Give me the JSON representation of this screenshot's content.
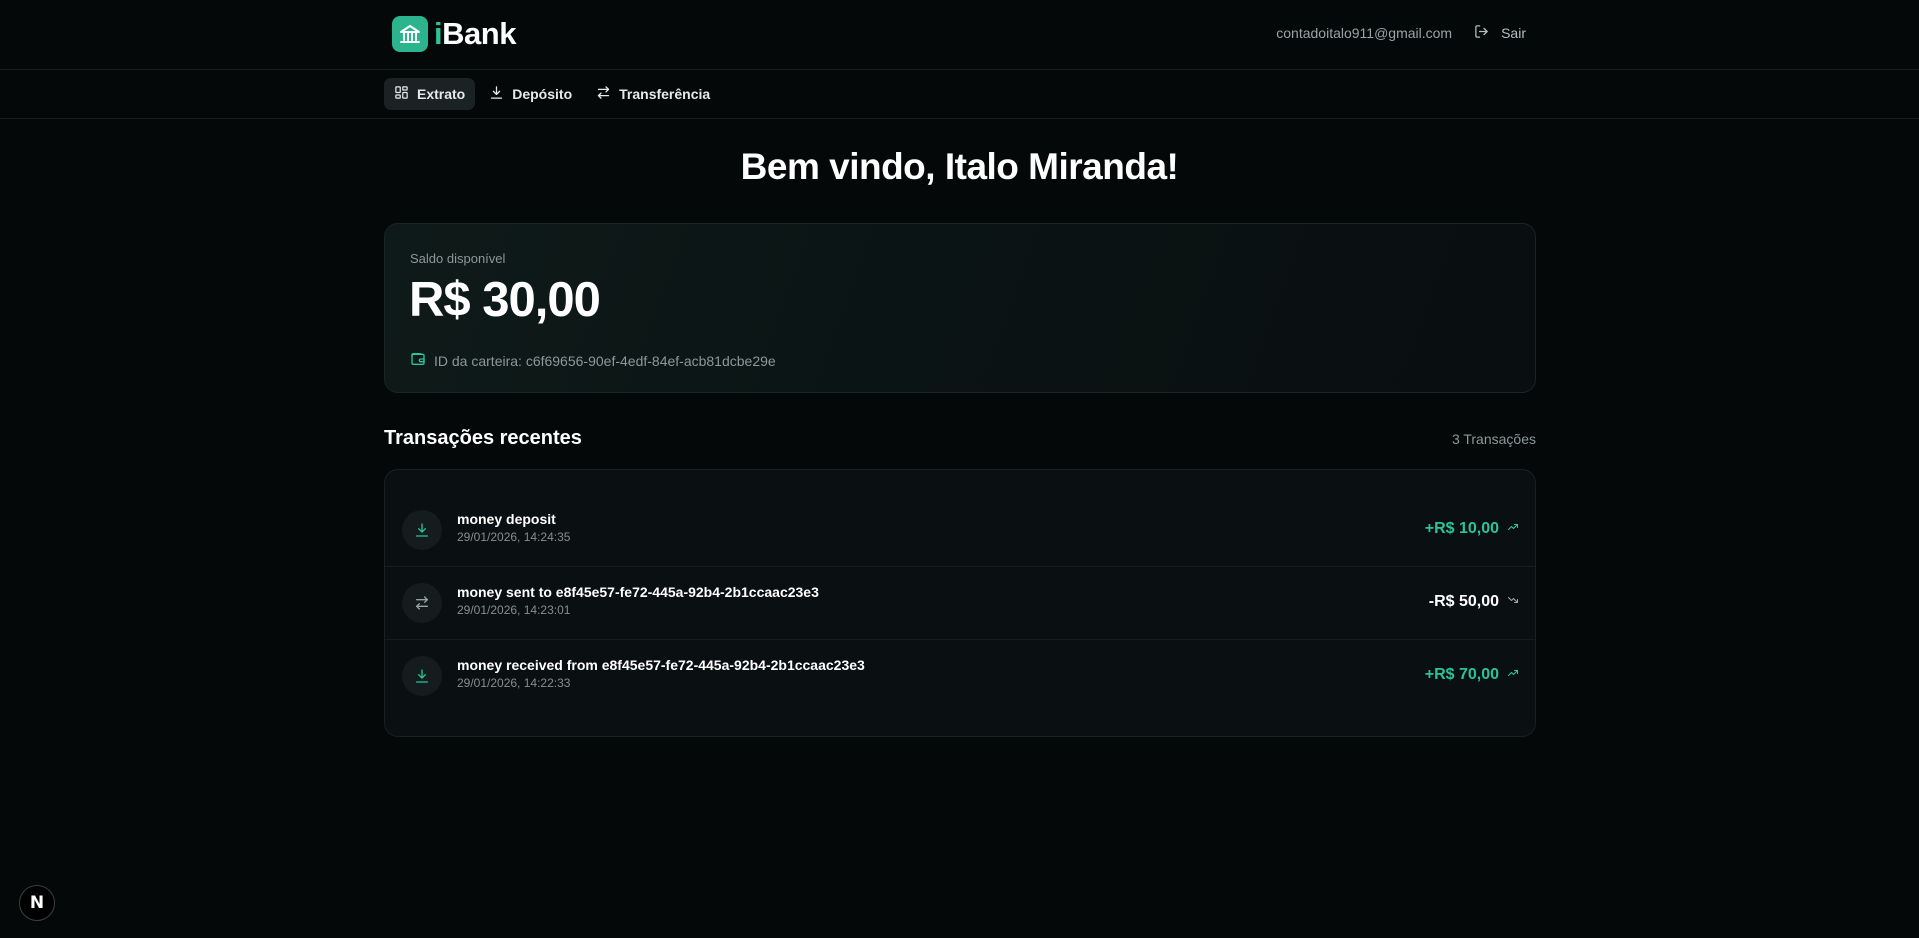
{
  "header": {
    "brand": {
      "prefix": "i",
      "name": "Bank"
    },
    "user_email": "contadoitalo911@gmail.com",
    "logout_label": "Sair"
  },
  "nav": {
    "items": [
      {
        "label": "Extrato",
        "icon": "dashboard-icon",
        "active": true
      },
      {
        "label": "Depósito",
        "icon": "download-icon",
        "active": false
      },
      {
        "label": "Transferência",
        "icon": "transfer-icon",
        "active": false
      }
    ]
  },
  "welcome": "Bem vindo, Italo Miranda!",
  "balance": {
    "label": "Saldo disponível",
    "amount": "R$ 30,00",
    "wallet_text": "ID da carteira: c6f69656-90ef-4edf-84ef-acb81dcbe29e"
  },
  "transactions": {
    "title": "Transações recentes",
    "count_label": "3 Transações",
    "items": [
      {
        "description": "money deposit",
        "date": "29/01/2026, 14:24:35",
        "amount": "+R$ 10,00",
        "type": "credit",
        "icon": "download-icon",
        "trend_icon": "trending-up-icon"
      },
      {
        "description": "money sent to e8f45e57-fe72-445a-92b4-2b1ccaac23e3",
        "date": "29/01/2026, 14:23:01",
        "amount": "-R$ 50,00",
        "type": "debit",
        "icon": "transfer-icon",
        "trend_icon": "trending-down-icon"
      },
      {
        "description": "money received from e8f45e57-fe72-445a-92b4-2b1ccaac23e3",
        "date": "29/01/2026, 14:22:33",
        "amount": "+R$ 70,00",
        "type": "credit",
        "icon": "download-icon",
        "trend_icon": "trending-up-icon"
      }
    ]
  },
  "dev_badge": "N",
  "colors": {
    "background": "#050809",
    "accent": "#2bc497",
    "card_border": "#1c2426",
    "muted_text": "#8e9799"
  }
}
